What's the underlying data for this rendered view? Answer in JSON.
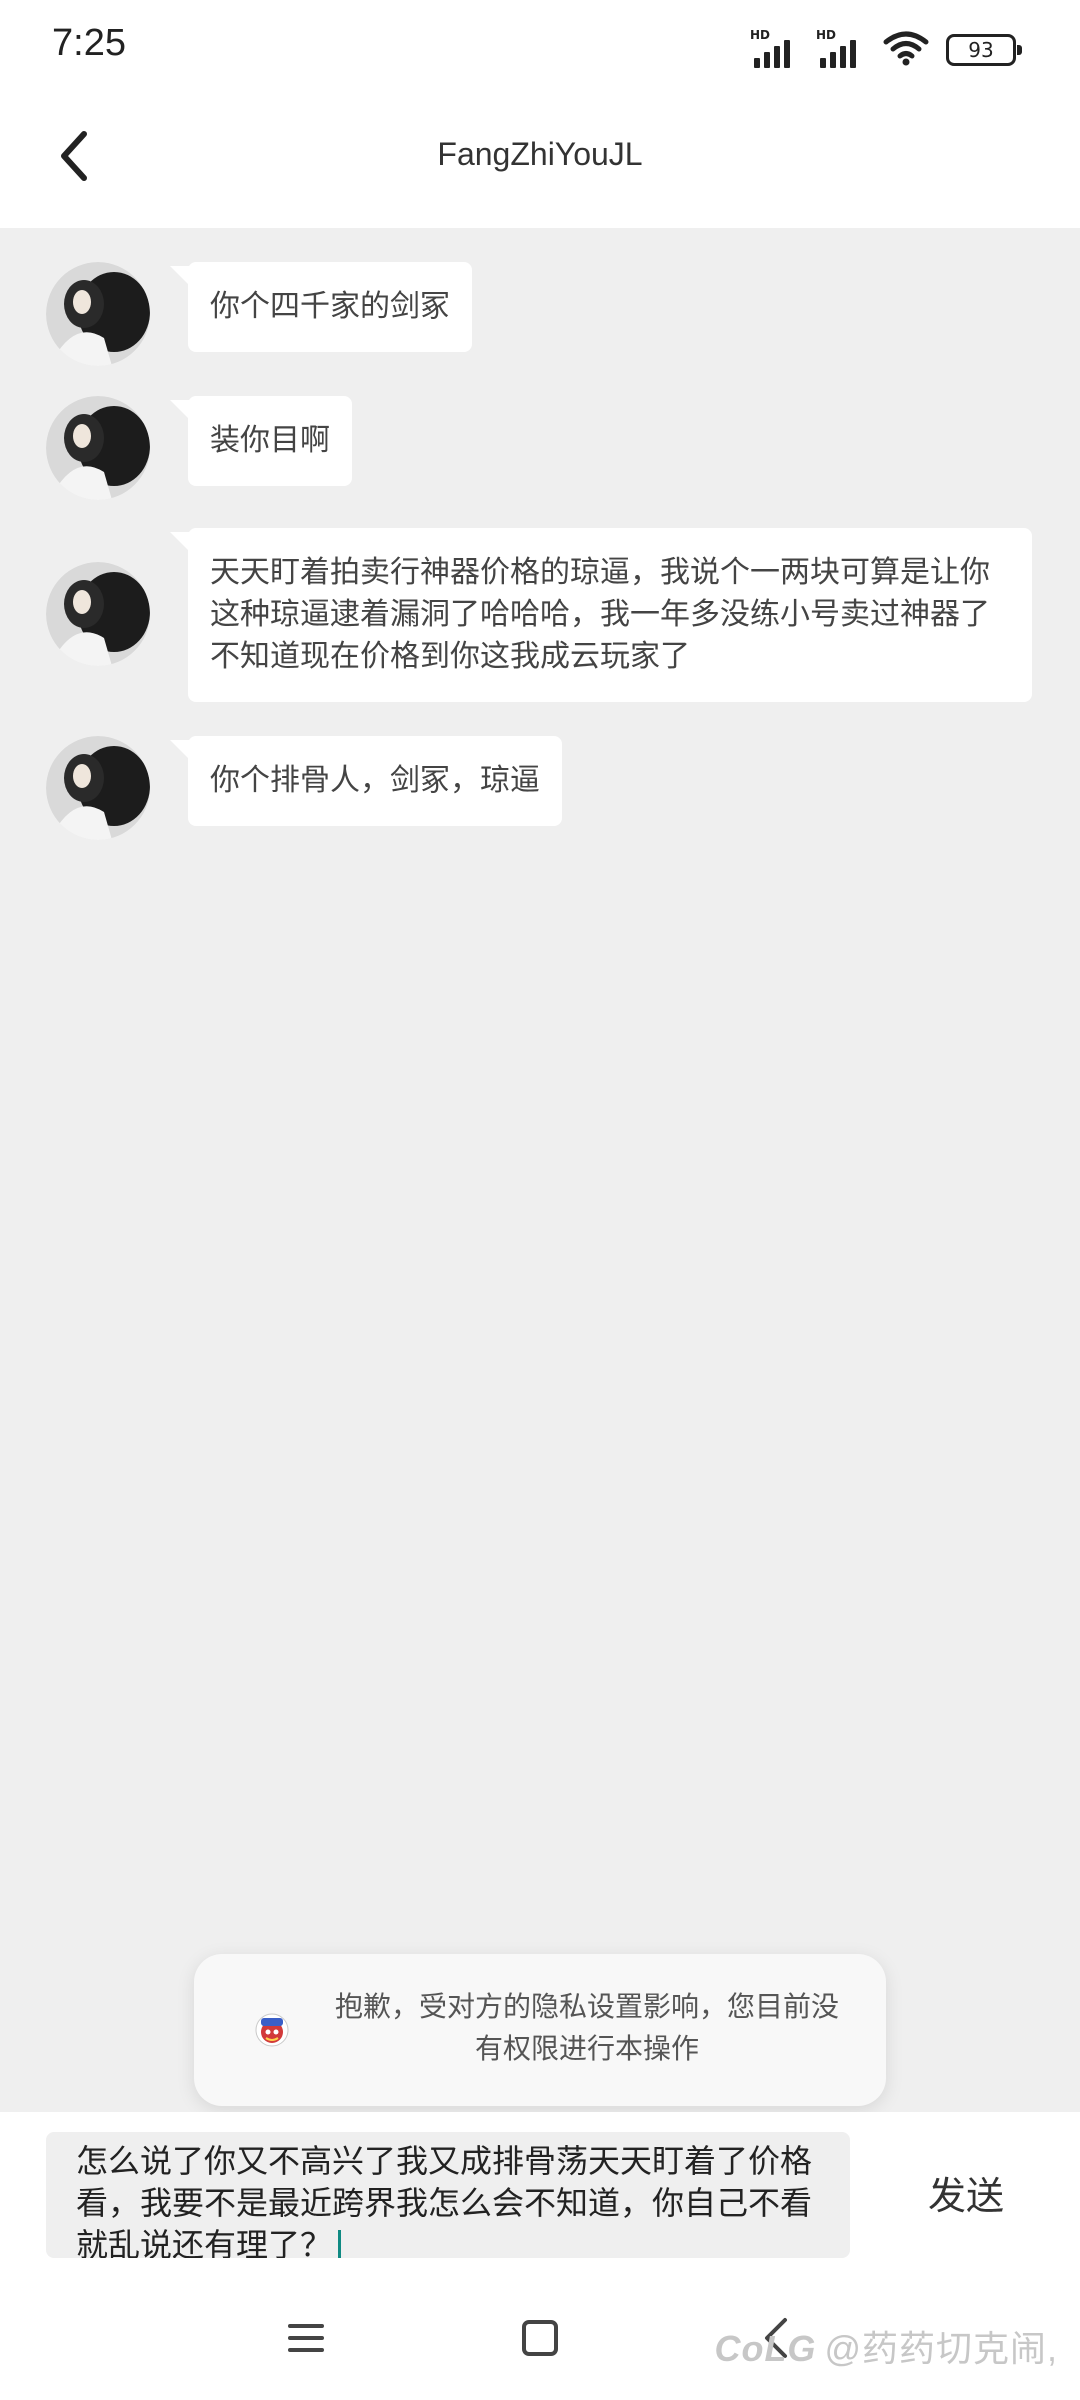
{
  "status_bar": {
    "time": "7:25",
    "signal_label": "HD",
    "battery": "93"
  },
  "header": {
    "title": "FangZhiYouJL"
  },
  "messages": [
    {
      "text": "你个四千家的剑冢"
    },
    {
      "text": "装你目啊"
    },
    {
      "text": "天天盯着拍卖行神器价格的琼逼，我说个一两块可算是让你这种琼逼逮着漏洞了哈哈哈，我一年多没练小号卖过神器了不知道现在价格到你这我成云玩家了"
    },
    {
      "text": "你个排骨人，剑冢，琼逼"
    }
  ],
  "toast": {
    "text": "抱歉，受对方的隐私设置影响，您目前没有权限进行本操作"
  },
  "input": {
    "value": "怎么说了你又不高兴了我又成排骨荡天天盯着了价格看，我要不是最近跨界我怎么会不知道，你自己不看就乱说还有理了？"
  },
  "send_label": "发送",
  "watermark": {
    "logo": "CoLG",
    "text": "@药药切克闹,"
  }
}
